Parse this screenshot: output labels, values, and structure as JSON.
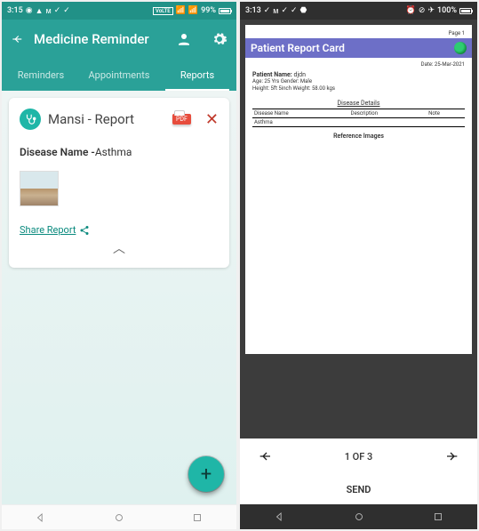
{
  "left": {
    "status": {
      "time": "3:15",
      "battery": "99%",
      "volte": "VoLTE"
    },
    "appbar_title": "Medicine Reminder",
    "tabs": [
      "Reminders",
      "Appointments",
      "Reports"
    ],
    "card": {
      "title": "Mansi - Report",
      "pdf": "PDF",
      "disease_label": "Disease Name -",
      "disease_value": "Asthma",
      "share": "Share Report"
    }
  },
  "right": {
    "status": {
      "time": "3:13",
      "battery": "100%"
    },
    "page": {
      "pgno": "Page 1",
      "header": "Patient Report Card",
      "date": "Date: 25-Mar-2021",
      "name_label": "Patient Name:",
      "name_value": "djdn",
      "info1": "Age: 25 Yrs  Gender: Male",
      "info2": "Height: 5ft 5inch   Weight: 58.00 kgs",
      "sect": "Disease Details",
      "th1": "Disease Name",
      "th2": "Description",
      "th3": "Note",
      "row1": "Asthma",
      "ref": "Reference Images"
    },
    "pager": "1 OF 3",
    "send": "SEND"
  }
}
